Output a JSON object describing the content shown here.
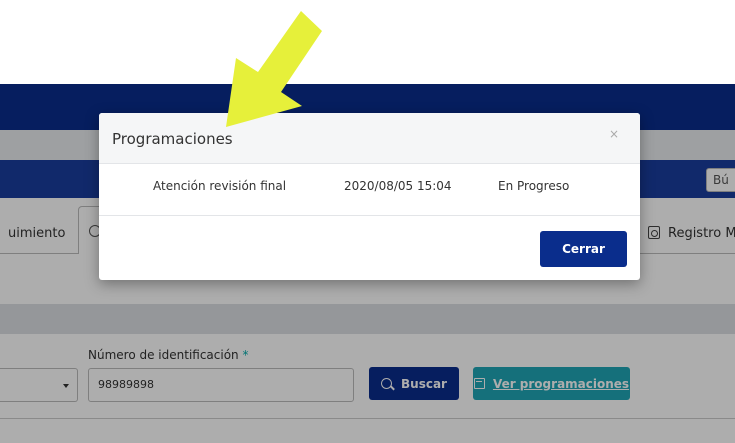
{
  "background": {
    "search_stub": "Bú",
    "tab_left_label": "uimiento",
    "tab_right_label": "Registro M",
    "form": {
      "id_label": "Número de identificación",
      "required_mark": "*",
      "id_value": "98989898",
      "search_button": "Buscar",
      "view_button": "Ver programaciones"
    }
  },
  "modal": {
    "title": "Programaciones",
    "close_symbol": "×",
    "row": {
      "activity": "Atención revisión final",
      "datetime": "2020/08/05 15:04",
      "status": "En Progreso"
    },
    "close_button": "Cerrar"
  },
  "colors": {
    "primary": "#0a2d8c",
    "teal": "#1fa6b5",
    "arrow": "#e6f03a"
  },
  "icons": [
    "magnifier-icon",
    "calendar-icon",
    "clipboard-user-icon",
    "circle-icon",
    "caret-down-icon",
    "close-icon",
    "annotation-arrow"
  ]
}
